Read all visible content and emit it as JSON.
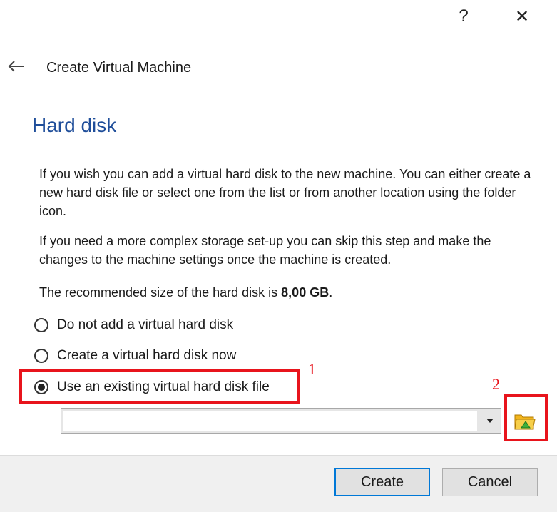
{
  "titlebar": {
    "help_label": "?",
    "close_label": "✕"
  },
  "wizard": {
    "title": "Create Virtual Machine"
  },
  "page": {
    "heading": "Hard disk",
    "paragraph1": "If you wish you can add a virtual hard disk to the new machine. You can either create a new hard disk file or select one from the list or from another location using the folder icon.",
    "paragraph2": "If you need a more complex storage set-up you can skip this step and make the changes to the machine settings once the machine is created.",
    "recommended_prefix": "The recommended size of the hard disk is ",
    "recommended_size": "8,00 GB",
    "recommended_suffix": "."
  },
  "options": [
    {
      "label": "Do not add a virtual hard disk",
      "selected": false
    },
    {
      "label": "Create a virtual hard disk now",
      "selected": false
    },
    {
      "label": "Use an existing virtual hard disk file",
      "selected": true
    }
  ],
  "disk_selector": {
    "value": ""
  },
  "annotations": {
    "marker1": "1",
    "marker2": "2",
    "color": "#e8141c"
  },
  "footer": {
    "create_label": "Create",
    "cancel_label": "Cancel"
  },
  "colors": {
    "heading": "#1f4e9a",
    "default_button_border": "#0078d7",
    "footer_bg": "#f0f0f0"
  },
  "icons": {
    "back": "back-arrow-icon",
    "combo": "chevron-down-icon",
    "folder": "folder-open-icon"
  }
}
